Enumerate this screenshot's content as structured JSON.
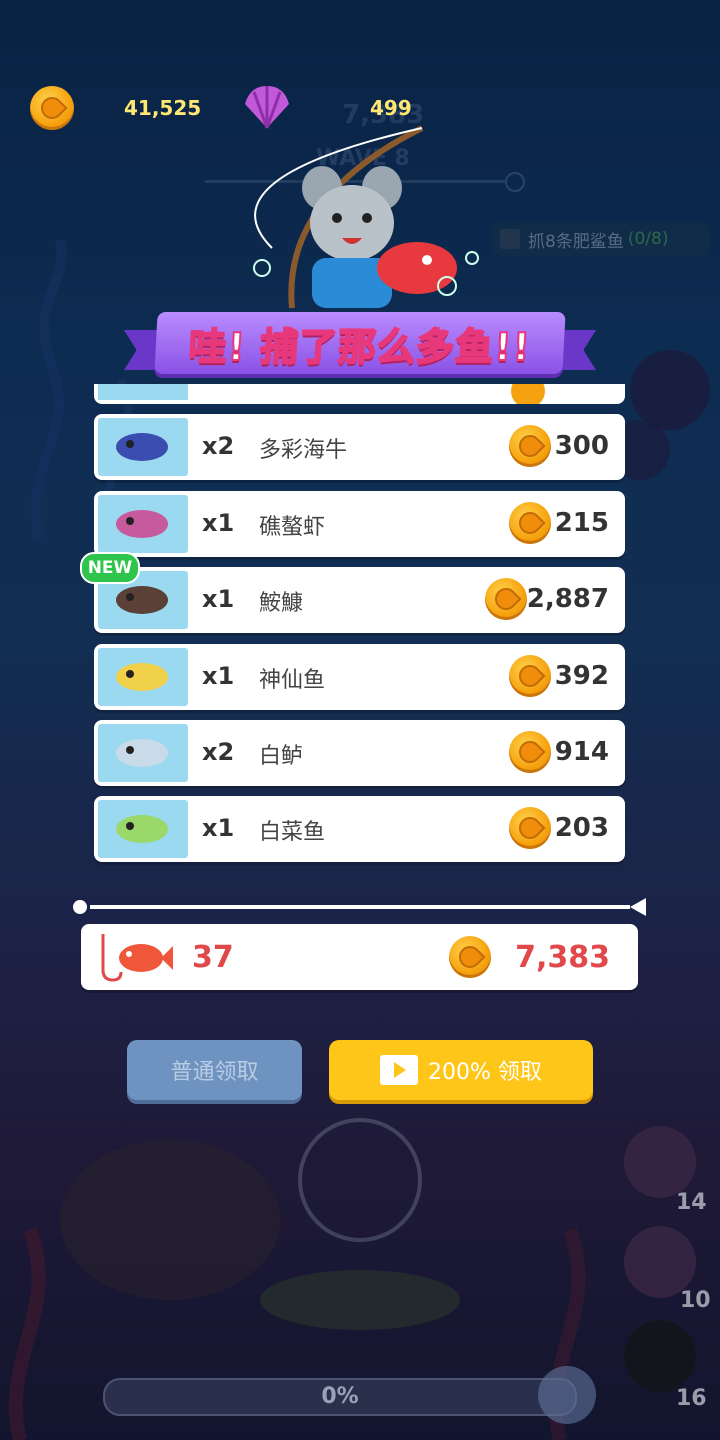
{
  "hud": {
    "coins": "41,525",
    "shells": "499",
    "bg_score": "7,383",
    "wave": "WAVE 8",
    "task": "抓8条肥鲨鱼",
    "task_progress": "(0/8)"
  },
  "banner": {
    "title": "哇! 捕了那么多鱼!!"
  },
  "catch_list": [
    {
      "qty": "x2",
      "name": "多彩海牛",
      "value": "300",
      "icon": "nudibranch-icon"
    },
    {
      "qty": "x1",
      "name": "礁螯虾",
      "value": "215",
      "icon": "lobster-icon"
    },
    {
      "qty": "x1",
      "name": "鮟鱇",
      "value": "2,887",
      "icon": "anglerfish-icon",
      "badge": "NEW"
    },
    {
      "qty": "x1",
      "name": "神仙鱼",
      "value": "392",
      "icon": "angelfish-icon"
    },
    {
      "qty": "x2",
      "name": "白鲈",
      "value": "914",
      "icon": "whitefish-icon"
    },
    {
      "qty": "x1",
      "name": "白菜鱼",
      "value": "203",
      "icon": "cabbage-fish-icon"
    }
  ],
  "total": {
    "fish_count": "37",
    "coins": "7,383"
  },
  "buttons": {
    "normal_claim": "普通领取",
    "bonus_claim": "200% 领取"
  },
  "side_items": [
    {
      "name": "bait-bucket-icon",
      "count": "14"
    },
    {
      "name": "net-icon",
      "count": "10"
    },
    {
      "name": "bomb-icon",
      "count": "16"
    }
  ],
  "progress": {
    "label": "0%",
    "value": 0
  },
  "colors": {
    "coin": "#f6a20e",
    "ribbon": "#8a52e6",
    "bonus_button": "#ffc61a",
    "normal_button": "#6f93c0",
    "total_text": "#e0484a"
  }
}
